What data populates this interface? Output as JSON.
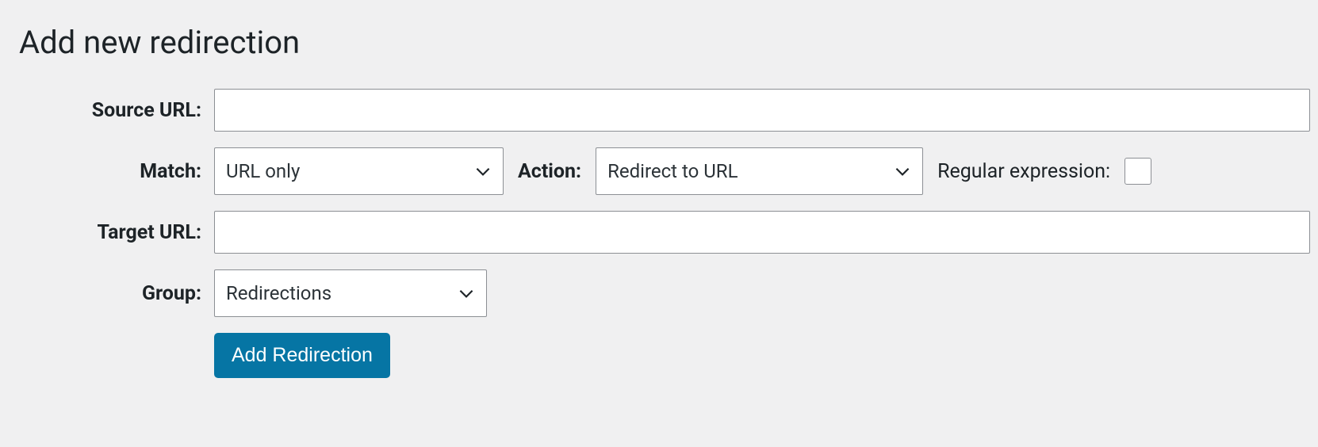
{
  "title": "Add new redirection",
  "labels": {
    "source_url": "Source URL:",
    "match": "Match:",
    "action": "Action:",
    "regex": "Regular expression:",
    "target_url": "Target URL:",
    "group": "Group:"
  },
  "fields": {
    "source_url": "",
    "match_selected": "URL only",
    "action_selected": "Redirect to URL",
    "regex_checked": false,
    "target_url": "",
    "group_selected": "Redirections"
  },
  "buttons": {
    "submit": "Add Redirection"
  }
}
